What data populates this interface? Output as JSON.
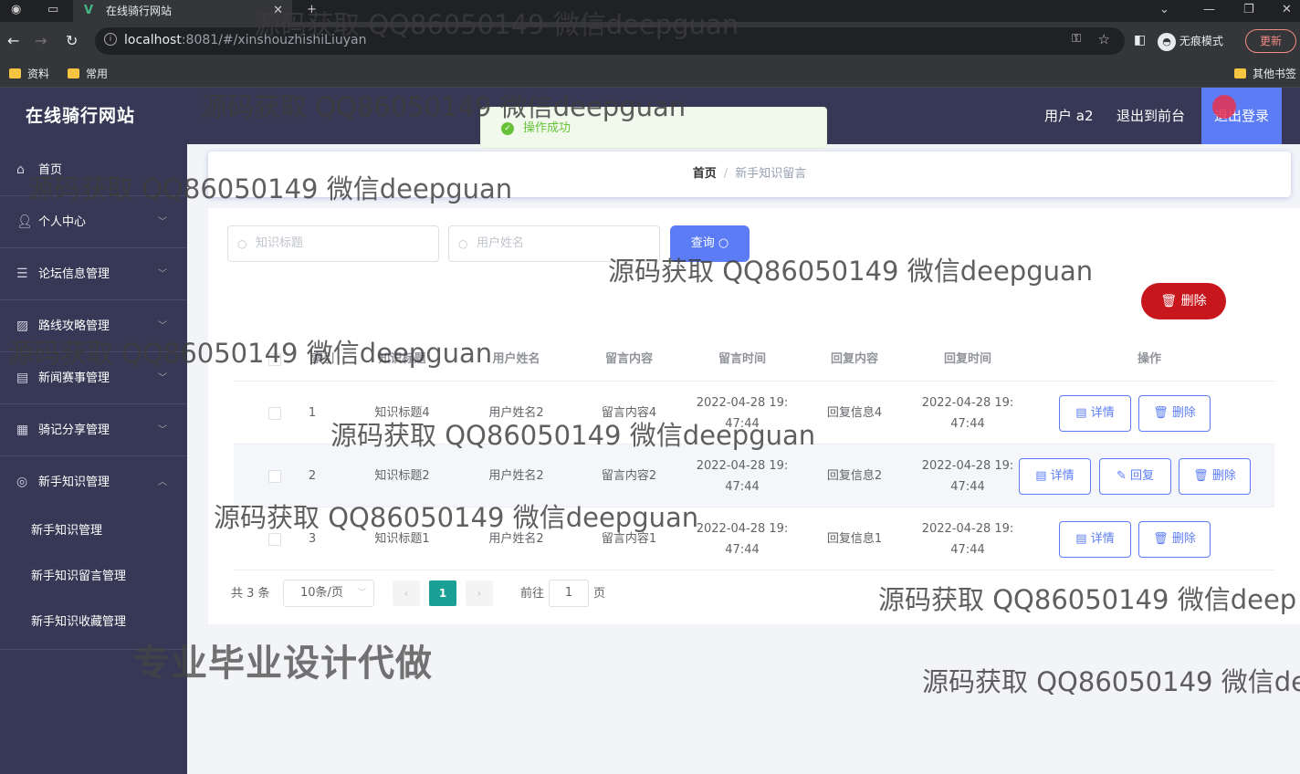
{
  "browser": {
    "tab_title": "在线骑行网站",
    "tab_logo": "V",
    "url_host": "localhost",
    "url_rest": ":8081/#/xinshouzhishiLiuyan",
    "incognito_label": "无痕模式",
    "update_label": "更新",
    "bookmarks": [
      "资料",
      "常用"
    ],
    "other_bookmarks": "其他书签"
  },
  "app": {
    "title": "在线骑行网站",
    "user_label": "用户 a2",
    "back_front_label": "退出到前台",
    "logout_label": "退出登录"
  },
  "sidebar": {
    "items": [
      {
        "label": "首页",
        "icon": "home-icon"
      },
      {
        "label": "个人中心",
        "icon": "user-icon"
      },
      {
        "label": "论坛信息管理",
        "icon": "list-icon"
      },
      {
        "label": "路线攻略管理",
        "icon": "chart-icon"
      },
      {
        "label": "新闻赛事管理",
        "icon": "news-icon"
      },
      {
        "label": "骑记分享管理",
        "icon": "grid-icon"
      },
      {
        "label": "新手知识管理",
        "icon": "compass-icon"
      }
    ],
    "sub_items": [
      "新手知识管理",
      "新手知识留言管理",
      "新手知识收藏管理"
    ]
  },
  "toast": {
    "message": "操作成功"
  },
  "breadcrumb": {
    "home": "首页",
    "separator": "/",
    "current": "新手知识留言"
  },
  "search": {
    "title_placeholder": "知识标题",
    "user_placeholder": "用户姓名",
    "query_label": "查询"
  },
  "actions": {
    "batch_delete_label": "删除"
  },
  "table": {
    "headers": [
      "索引",
      "知识标题",
      "用户姓名",
      "留言内容",
      "留言时间",
      "回复内容",
      "回复时间",
      "操作"
    ],
    "rows": [
      {
        "index": "1",
        "title": "知识标题4",
        "user": "用户姓名2",
        "content": "留言内容4",
        "time_date": "2022-04-28 19:",
        "time_clock": "47:44",
        "reply": "回复信息4",
        "reply_date": "2022-04-28 19:",
        "reply_clock": "47:44"
      },
      {
        "index": "2",
        "title": "知识标题2",
        "user": "用户姓名2",
        "content": "留言内容2",
        "time_date": "2022-04-28 19:",
        "time_clock": "47:44",
        "reply": "回复信息2",
        "reply_date": "2022-04-28 19:",
        "reply_clock": "47:44"
      },
      {
        "index": "3",
        "title": "知识标题1",
        "user": "用户姓名2",
        "content": "留言内容1",
        "time_date": "2022-04-28 19:",
        "time_clock": "47:44",
        "reply": "回复信息1",
        "reply_date": "2022-04-28 19:",
        "reply_clock": "47:44"
      }
    ],
    "op_detail": "详情",
    "op_reply": "回复",
    "op_delete": "删除"
  },
  "pagination": {
    "total": "共 3 条",
    "page_size": "10条/页",
    "current_page": "1",
    "goto_label": "前往",
    "goto_value": "1",
    "page_suffix": "页"
  },
  "watermark": {
    "text": "源码获取 QQ86050149 微信deepguan",
    "text_cut1": "源码获取 QQ86050149 微信deep",
    "text_cut2": "源码获取 QQ86050149 微信de",
    "big": "专业毕业设计代做"
  },
  "colors": {
    "sidebar": "#373855",
    "accent": "#5b7cf5",
    "danger": "#c8161d",
    "pager_active": "#1aa094",
    "toast": "#67c23a"
  }
}
